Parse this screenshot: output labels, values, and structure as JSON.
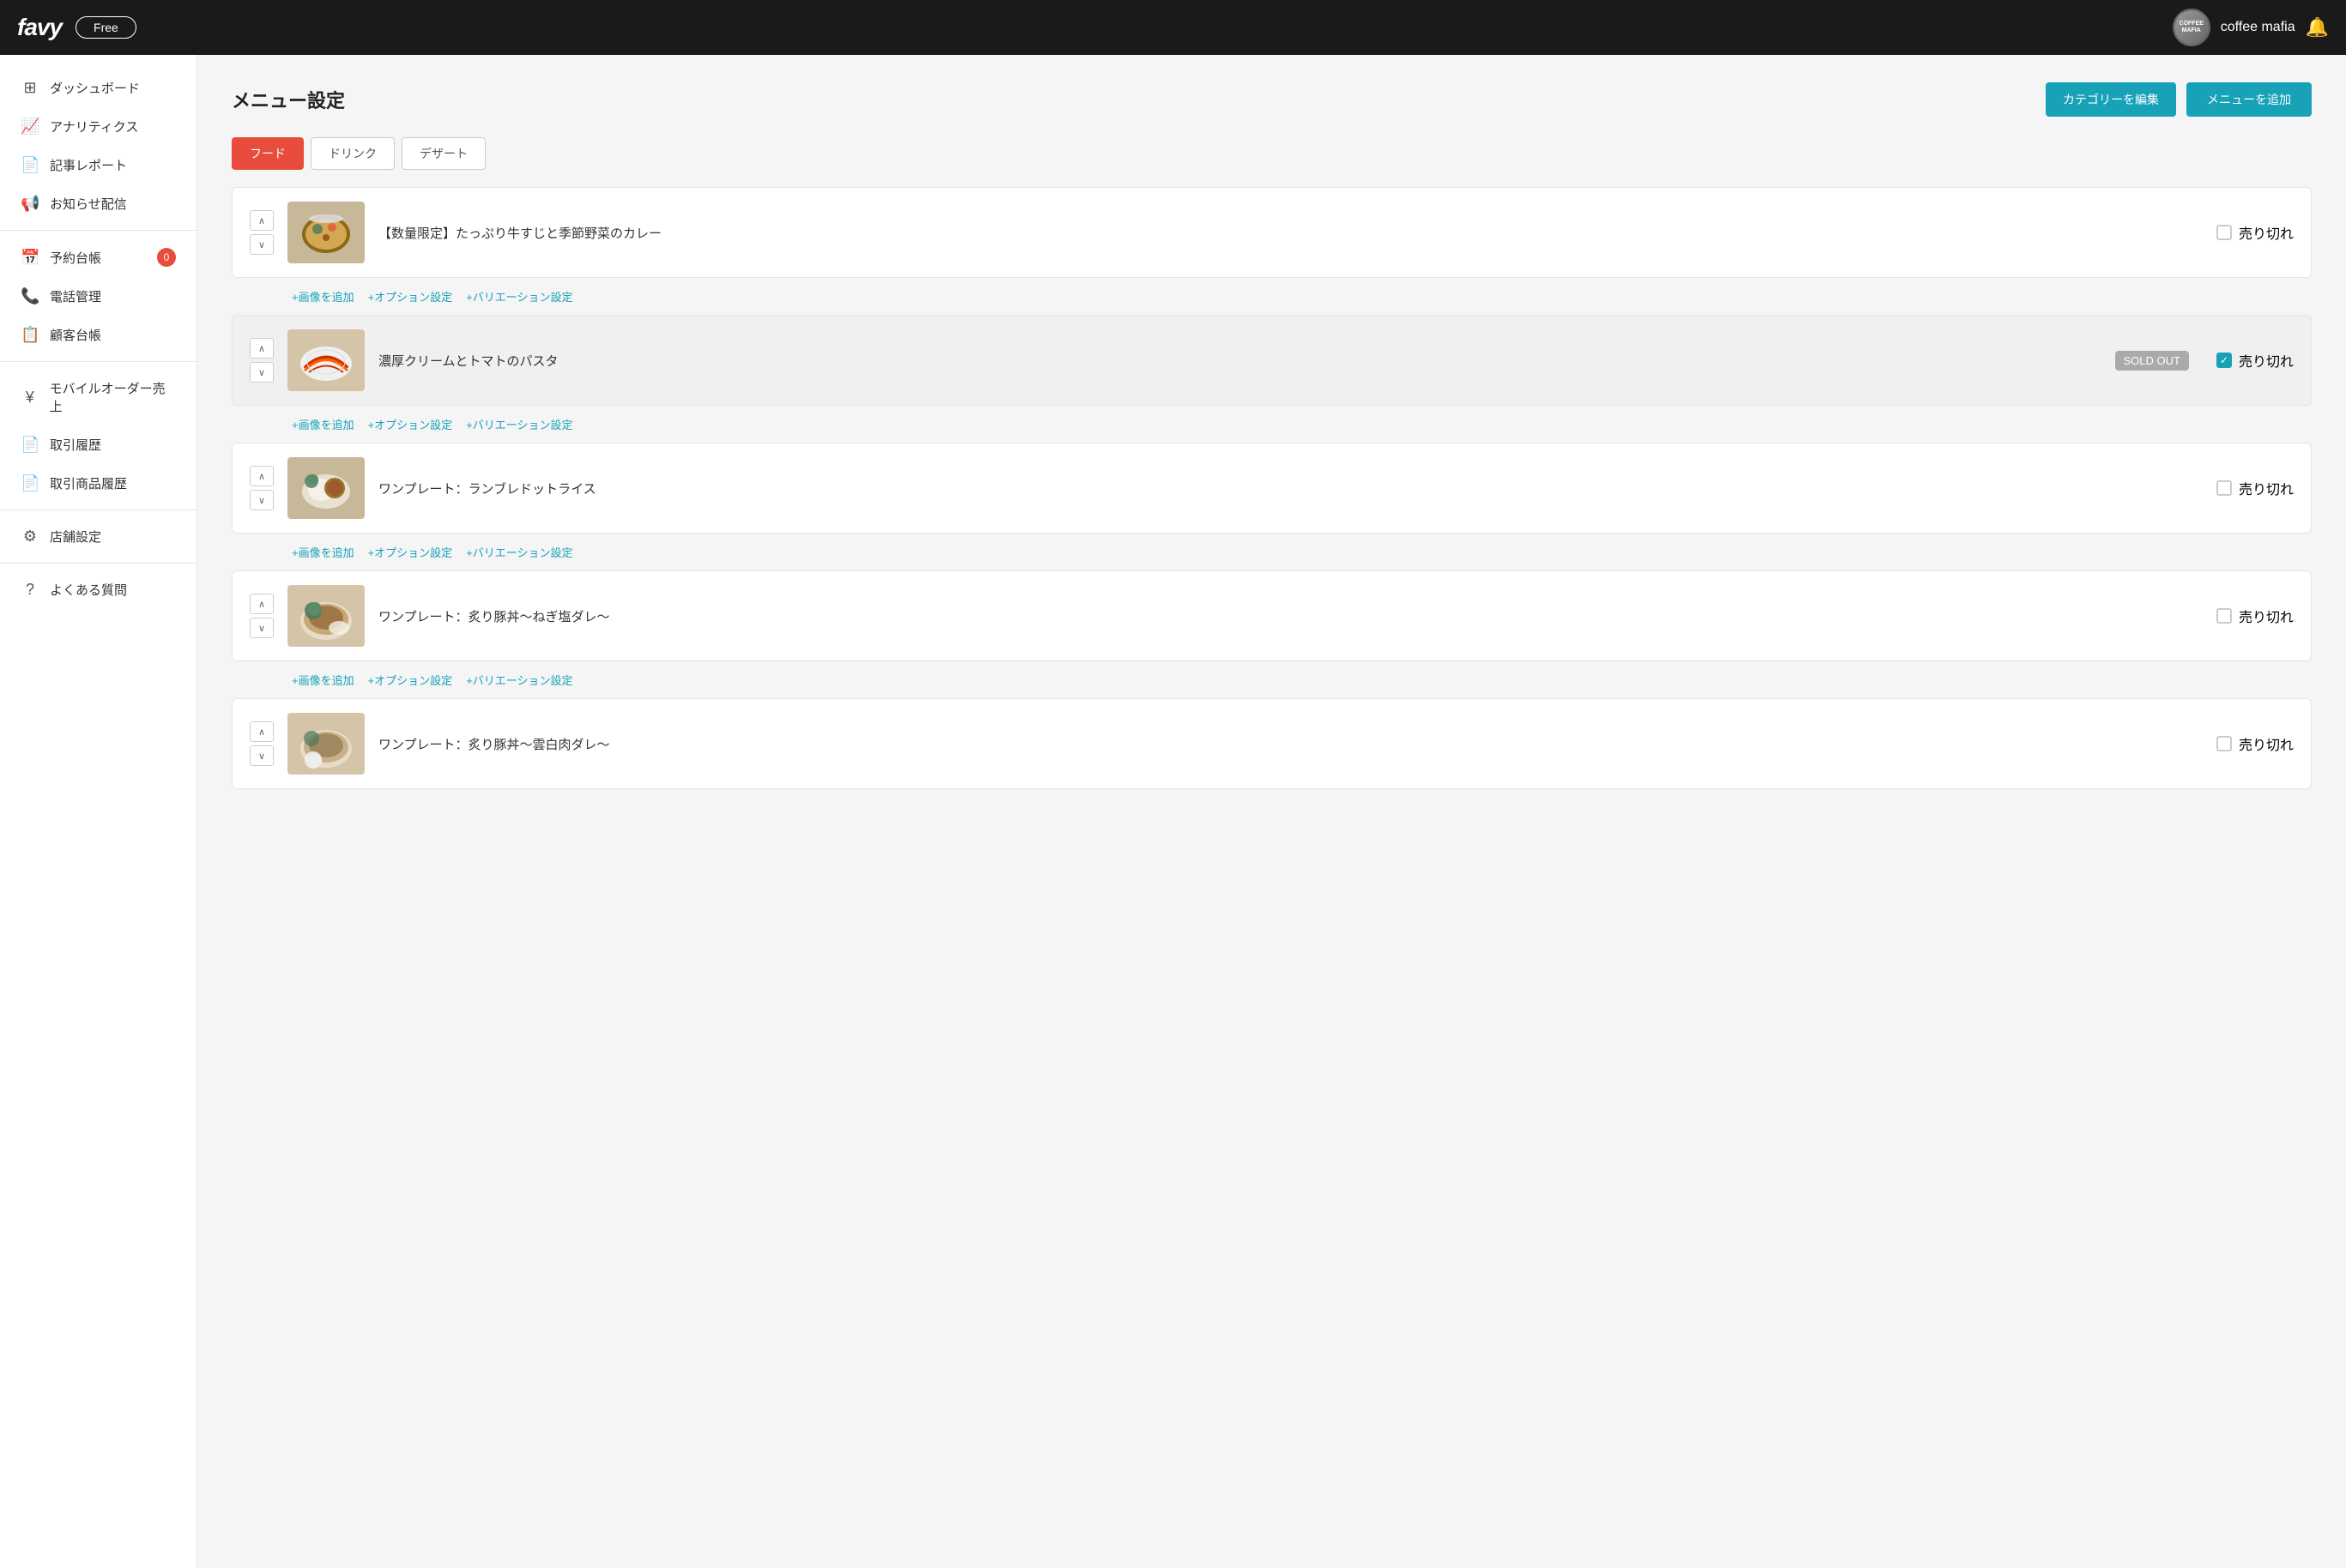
{
  "header": {
    "logo": "favy",
    "badge": "Free",
    "store_name": "coffee mafia",
    "avatar_line1": "COFFEE",
    "avatar_line2": "MAFIA",
    "bell_icon": "🔔"
  },
  "sidebar": {
    "items": [
      {
        "id": "dashboard",
        "label": "ダッシュボード",
        "icon": "⊞"
      },
      {
        "id": "analytics",
        "label": "アナリティクス",
        "icon": "📈"
      },
      {
        "id": "report",
        "label": "記事レポート",
        "icon": "📄"
      },
      {
        "id": "notification",
        "label": "お知らせ配信",
        "icon": "📢"
      },
      {
        "id": "reservation",
        "label": "予約台帳",
        "icon": "📅",
        "badge": "0"
      },
      {
        "id": "phone",
        "label": "電話管理",
        "icon": "📞"
      },
      {
        "id": "customer",
        "label": "顧客台帳",
        "icon": "📋"
      },
      {
        "id": "mobile-order",
        "label": "モバイルオーダー売上",
        "icon": "¥"
      },
      {
        "id": "transaction",
        "label": "取引履歴",
        "icon": "📄"
      },
      {
        "id": "product-history",
        "label": "取引商品履歴",
        "icon": "📄"
      },
      {
        "id": "store-settings",
        "label": "店舗設定",
        "icon": "⚙"
      },
      {
        "id": "faq",
        "label": "よくある質問",
        "icon": "?"
      }
    ]
  },
  "page": {
    "title": "メニュー設定",
    "edit_category_btn": "カテゴリーを編集",
    "add_menu_btn": "メニューを追加"
  },
  "tabs": [
    {
      "id": "food",
      "label": "フード",
      "active": true
    },
    {
      "id": "drink",
      "label": "ドリンク",
      "active": false
    },
    {
      "id": "dessert",
      "label": "デザート",
      "active": false
    }
  ],
  "menu_items": [
    {
      "id": 1,
      "name": "【数量限定】たっぷり牛すじと季節野菜のカレー",
      "sold_out": false,
      "sold_out_badge": false,
      "checked": false,
      "sold_out_label": "売り切れ"
    },
    {
      "id": 2,
      "name": "濃厚クリームとトマトのパスタ",
      "sold_out": true,
      "sold_out_badge": true,
      "sold_out_badge_text": "SOLD OUT",
      "checked": true,
      "sold_out_label": "売り切れ"
    },
    {
      "id": 3,
      "name": "ワンプレート：ランブレドットライス",
      "sold_out": false,
      "sold_out_badge": false,
      "checked": false,
      "sold_out_label": "売り切れ"
    },
    {
      "id": 4,
      "name": "ワンプレート：炙り豚丼〜ねぎ塩ダレ〜",
      "sold_out": false,
      "sold_out_badge": false,
      "checked": false,
      "sold_out_label": "売り切れ"
    },
    {
      "id": 5,
      "name": "ワンプレート：炙り豚丼〜雲白肉ダレ〜",
      "sold_out": false,
      "sold_out_badge": false,
      "checked": false,
      "sold_out_label": "売り切れ"
    }
  ],
  "action_links": {
    "add_image": "+画像を追加",
    "option_settings": "+オプション設定",
    "variation_settings": "+バリエーション設定"
  }
}
